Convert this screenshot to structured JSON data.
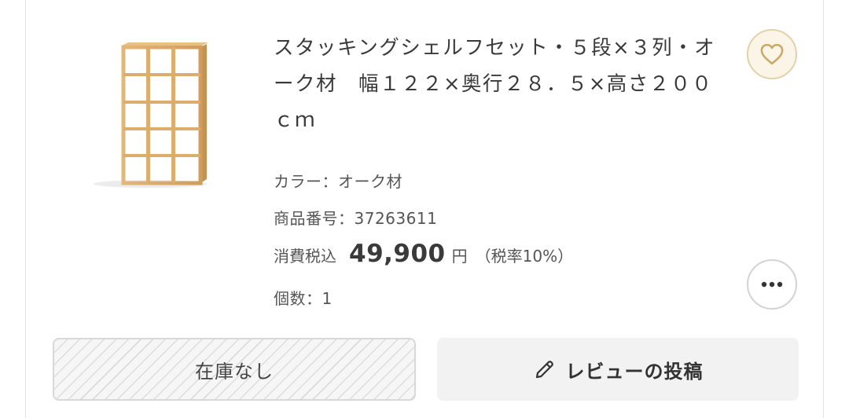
{
  "product": {
    "title": "スタッキングシェルフセット・５段×３列・オーク材　幅１２２×奥行２８．５×高さ２００ｃｍ",
    "color_line": "カラー：オーク材",
    "number_line": "商品番号：37263611",
    "price_label": "消費税込",
    "price_value": "49,900",
    "price_unit": "円",
    "price_tax": "（税率10%）",
    "qty_line": "個数：1"
  },
  "buttons": {
    "stock_label": "在庫なし",
    "review_label": "レビューの投稿"
  },
  "icons": {
    "favorite": "heart-icon",
    "more": "more-dots-icon",
    "review": "pencil-icon"
  },
  "colors": {
    "accent": "#e2d1aa",
    "favorite_bg": "#fbf5e8",
    "wood": "#d9a968"
  }
}
